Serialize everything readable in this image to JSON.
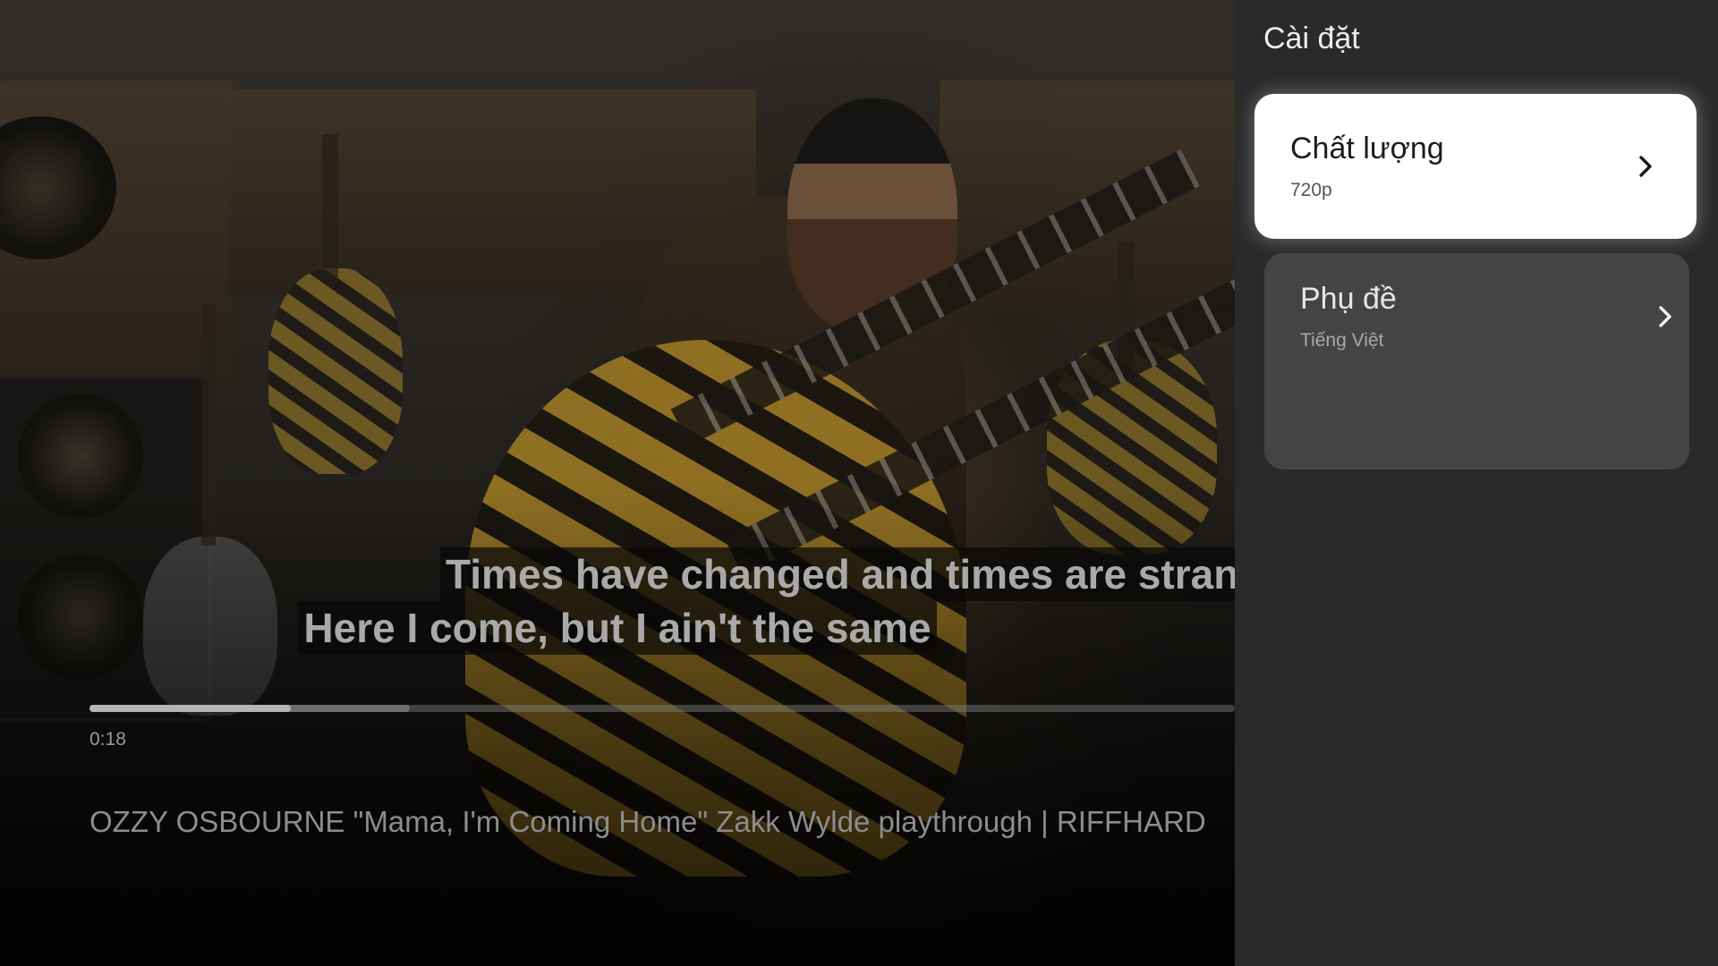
{
  "video": {
    "subtitles": [
      "Times have changed and times are strang",
      "Here I come, but I ain't the same"
    ],
    "progress": {
      "current_time": "0:18",
      "played_fraction": 0.176,
      "buffered_fraction": 0.28
    },
    "title": "OZZY OSBOURNE \"Mama, I'm Coming Home\" Zakk Wylde playthrough | RIFFHARD"
  },
  "settings": {
    "title": "Cài đặt",
    "items": [
      {
        "label": "Chất lượng",
        "value": "720p",
        "focused": true,
        "icon": "chevron-right-icon"
      },
      {
        "label": "Phụ đề",
        "value": "Tiếng Việt",
        "focused": false,
        "icon": "chevron-right-icon"
      }
    ]
  },
  "colors": {
    "panel_background": "#2a2a2a",
    "focused_card": "#ffffff",
    "card": "#444444"
  }
}
